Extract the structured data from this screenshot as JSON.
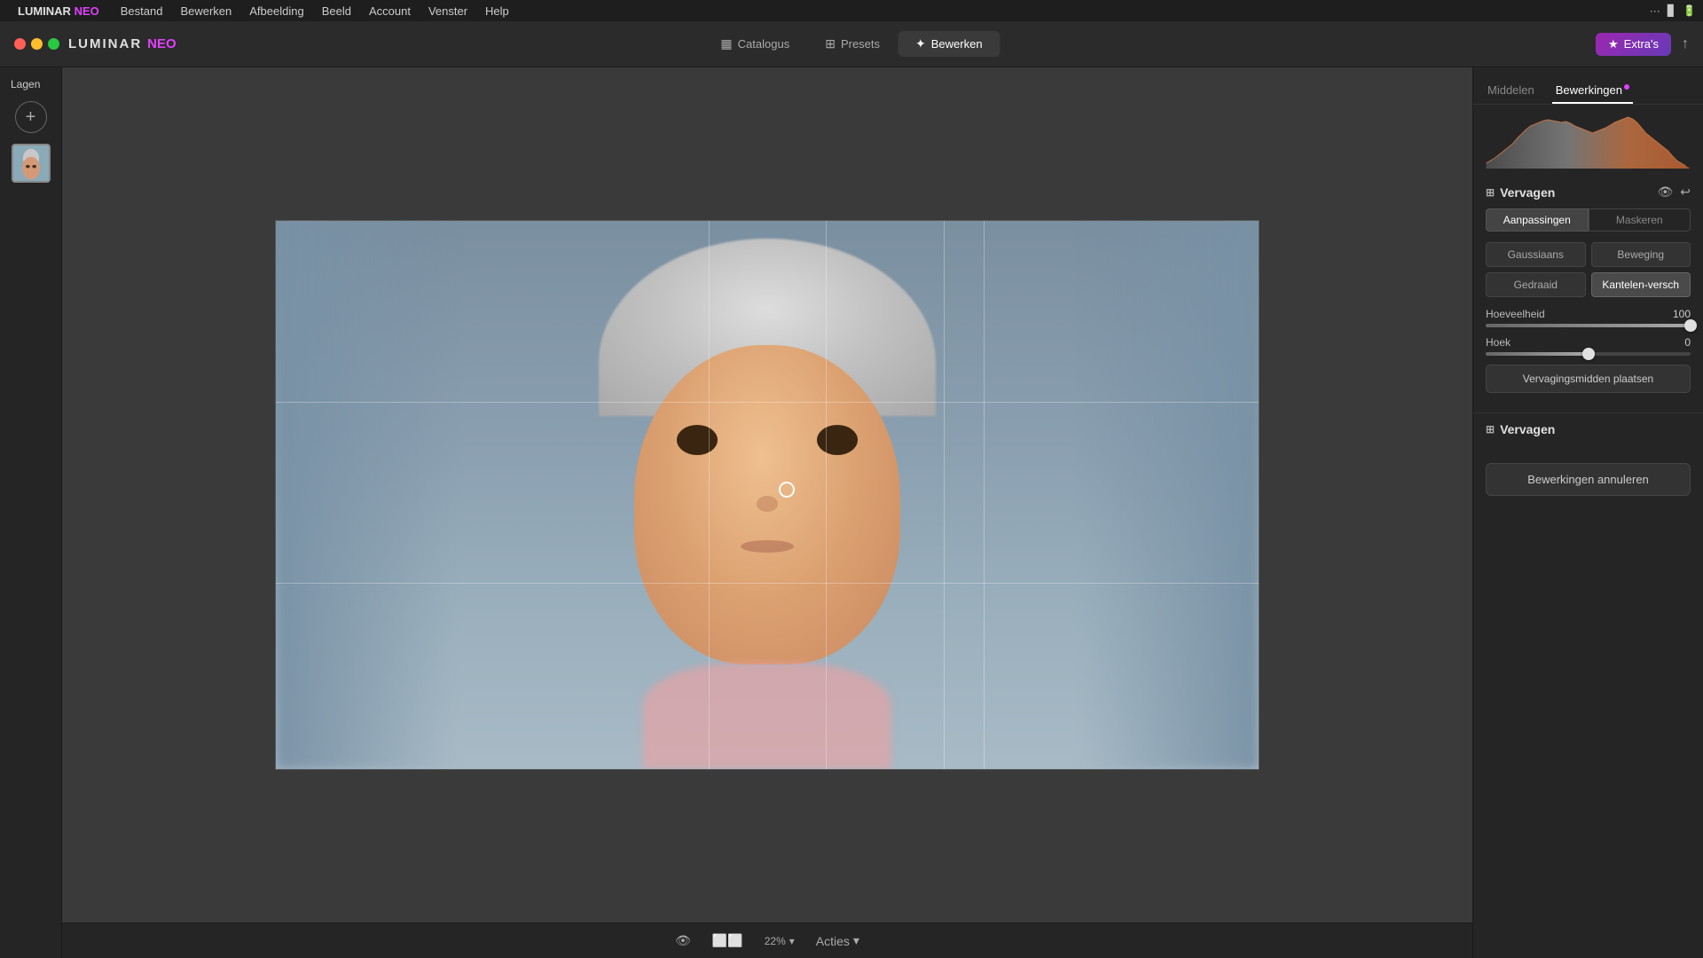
{
  "menubar": {
    "apple_symbol": "",
    "app_name": "Luminar Neo",
    "items": [
      "Bestand",
      "Bewerken",
      "Afbeelding",
      "Beeld",
      "Account",
      "Venster",
      "Help"
    ],
    "right_icons": [
      "●●●",
      "📶",
      "🔋"
    ]
  },
  "toolbar": {
    "logo_text": "LUMINAR",
    "logo_neo": "NEO",
    "nav_items": [
      {
        "id": "catalogus",
        "icon": "▦",
        "label": "Catalogus",
        "active": false
      },
      {
        "id": "presets",
        "icon": "⊞",
        "label": "Presets",
        "active": false
      },
      {
        "id": "bewerken",
        "icon": "✦",
        "label": "Bewerken",
        "active": true
      }
    ],
    "extras_label": "Extra's",
    "share_icon": "↑"
  },
  "left_panel": {
    "title": "Lagen",
    "add_button_label": "+",
    "layer_thumb_alt": "child portrait"
  },
  "right_panel": {
    "tabs": [
      {
        "id": "middelen",
        "label": "Middelen",
        "active": false
      },
      {
        "id": "bewerkingen",
        "label": "Bewerkingen",
        "active": true,
        "dot": true
      }
    ],
    "section1": {
      "title": "Vervagen",
      "sub_tabs": [
        {
          "label": "Aanpassingen",
          "active": true
        },
        {
          "label": "Maskeren",
          "active": false
        }
      ],
      "blur_types": [
        {
          "label": "Gaussiaans",
          "active": false
        },
        {
          "label": "Beweging",
          "active": false
        },
        {
          "label": "Gedraaid",
          "active": false
        },
        {
          "label": "Kantelen-versch",
          "active": true
        }
      ],
      "hoeveelheid_label": "Hoeveelheid",
      "hoeveelheid_value": "100",
      "hoeveelheid_percent": 100,
      "hoek_label": "Hoek",
      "hoek_value": "0",
      "hoek_percent": 50,
      "place_center_btn": "Vervagingsmidden plaatsen"
    },
    "section2": {
      "title": "Vervagen"
    },
    "cancel_btn": "Bewerkingen annuleren"
  },
  "canvas": {
    "zoom": "22%",
    "zoom_label": "22%",
    "actions_label": "Acties",
    "actions_arrow": "▾"
  },
  "histogram": {
    "description": "RGB histogram showing peaks in shadows and midtones"
  }
}
